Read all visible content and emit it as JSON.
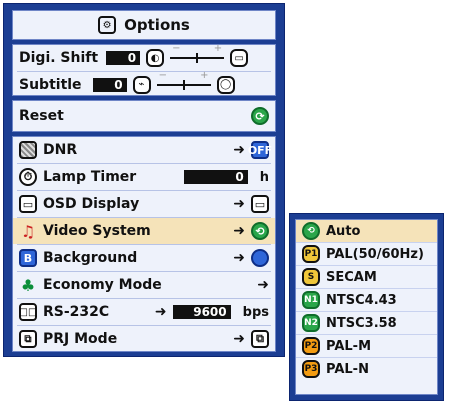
{
  "window": {
    "title": "Options"
  },
  "settings": {
    "digi_shift": {
      "label": "Digi. Shift",
      "value": "0"
    },
    "subtitle": {
      "label": "Subtitle",
      "value": "0"
    },
    "reset": {
      "label": "Reset"
    }
  },
  "menu_items": [
    {
      "label": "DNR",
      "has_arrow": true,
      "value_icon": "dnr-off-icon",
      "value_icon_text": "OFF"
    },
    {
      "label": "Lamp Timer",
      "value": "0",
      "unit": "h"
    },
    {
      "label": "OSD Display",
      "has_arrow": true,
      "value_icon": "osd-display-icon"
    },
    {
      "label": "Video System",
      "has_arrow": true,
      "value_icon": "auto-icon"
    },
    {
      "label": "Background",
      "has_arrow": true,
      "value_icon": "background-blue-icon"
    },
    {
      "label": "Economy Mode",
      "has_arrow": true
    },
    {
      "label": "RS-232C",
      "has_arrow": true,
      "value": "9600",
      "unit": "bps"
    },
    {
      "label": "PRJ Mode",
      "has_arrow": true,
      "value_icon": "prj-mode-icon"
    }
  ],
  "video_system_options": [
    {
      "label": "Auto",
      "badge": "A"
    },
    {
      "label": "PAL(50/60Hz)",
      "badge": "P1"
    },
    {
      "label": "SECAM",
      "badge": "S"
    },
    {
      "label": "NTSC4.43",
      "badge": "N1"
    },
    {
      "label": "NTSC3.58",
      "badge": "N2"
    },
    {
      "label": "PAL-M",
      "badge": "P2"
    },
    {
      "label": "PAL-N",
      "badge": "P3"
    }
  ],
  "colors": {
    "menu_bg": "#1c3e93",
    "panel_bg": "#eef2fb",
    "selected_bg": "#f5e3b9",
    "accent_blue": "#2f66d8",
    "accent_green": "#2aa64a"
  }
}
